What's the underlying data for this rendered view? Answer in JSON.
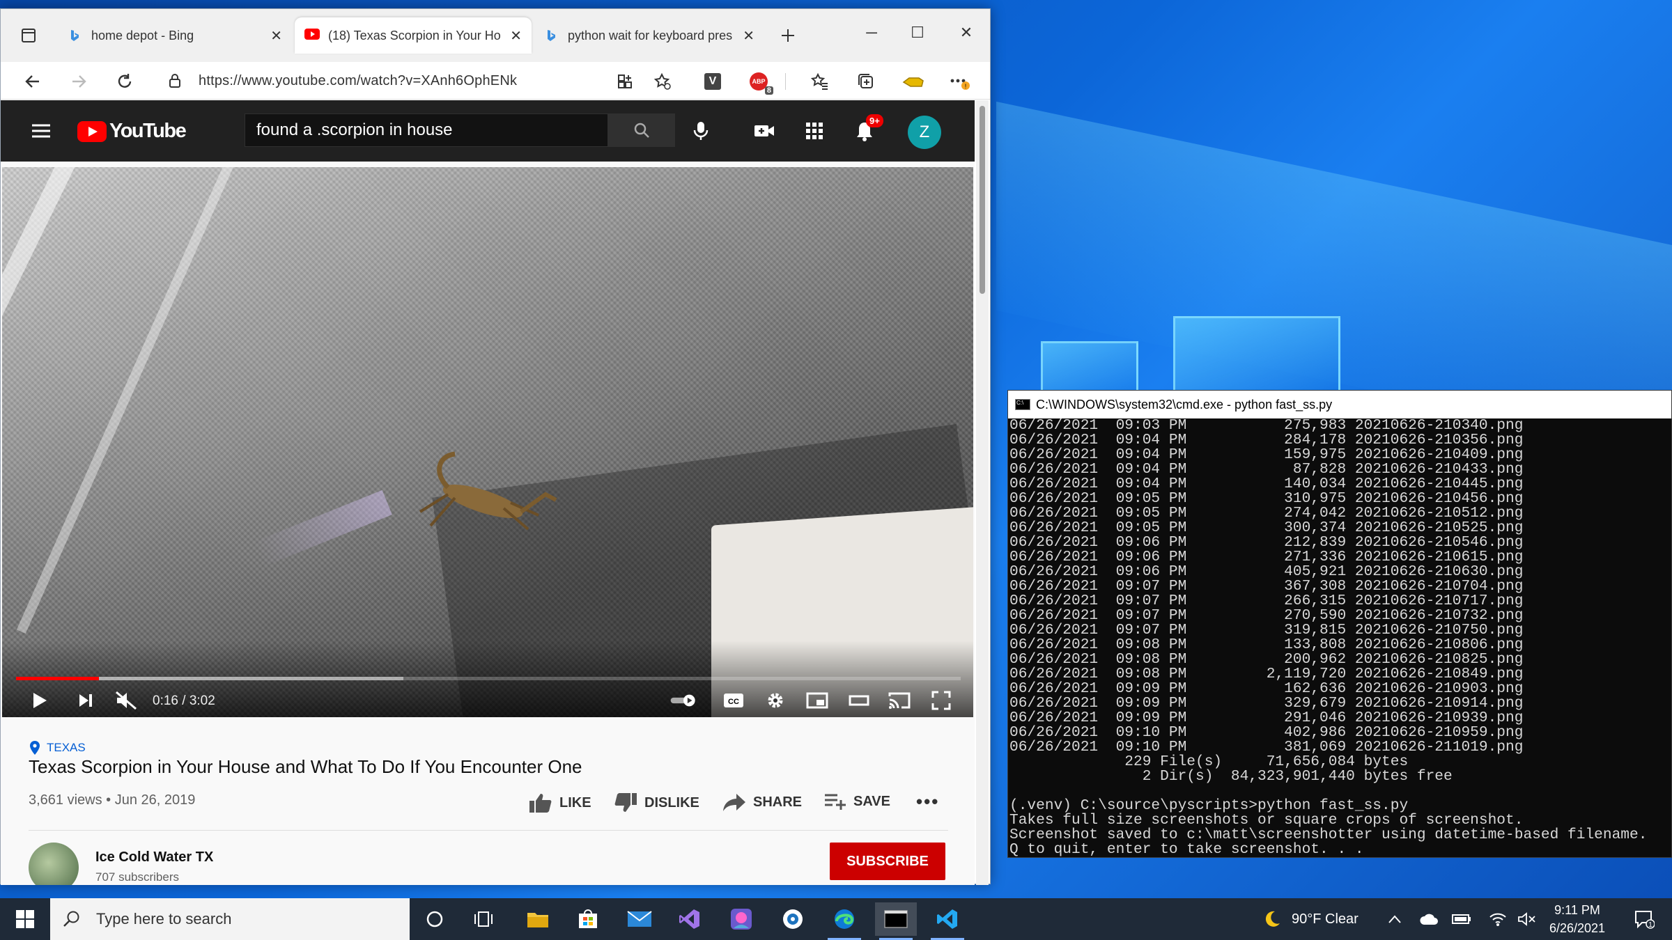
{
  "browser": {
    "tabs": [
      {
        "label": "home depot - Bing",
        "icon": "bing-icon",
        "active": false
      },
      {
        "label": "(18) Texas Scorpion in Your Ho",
        "icon": "youtube-icon",
        "active": true
      },
      {
        "label": "python wait for keyboard pres",
        "icon": "bing-icon",
        "active": false
      }
    ],
    "url": "https://www.youtube.com/watch?v=XAnh6OphENk",
    "extension_v_label": "V",
    "adblock_badge": "8"
  },
  "youtube": {
    "logo_text": "YouTube",
    "search_value": "found a .scorpion in house",
    "notification_badge": "9+",
    "avatar_letter": "Z",
    "player": {
      "time": "0:16 / 3:02",
      "played_fraction": 0.088,
      "buffered_fraction": 0.41
    },
    "video": {
      "location_tag": "TEXAS",
      "title": "Texas Scorpion in Your House and What To Do If You Encounter One",
      "views_date": "3,661 views • Jun 26, 2019",
      "like_label": "LIKE",
      "dislike_label": "DISLIKE",
      "share_label": "SHARE",
      "save_label": "SAVE"
    },
    "channel": {
      "name": "Ice Cold Water TX",
      "subscribers": "707 subscribers",
      "subscribe_label": "SUBSCRIBE"
    }
  },
  "cmd": {
    "title": "C:\\WINDOWS\\system32\\cmd.exe - python  fast_ss.py",
    "lines": [
      "06/26/2021  09:03 PM           275,983 20210626-210340.png",
      "06/26/2021  09:04 PM           284,178 20210626-210356.png",
      "06/26/2021  09:04 PM           159,975 20210626-210409.png",
      "06/26/2021  09:04 PM            87,828 20210626-210433.png",
      "06/26/2021  09:04 PM           140,034 20210626-210445.png",
      "06/26/2021  09:05 PM           310,975 20210626-210456.png",
      "06/26/2021  09:05 PM           274,042 20210626-210512.png",
      "06/26/2021  09:05 PM           300,374 20210626-210525.png",
      "06/26/2021  09:06 PM           212,839 20210626-210546.png",
      "06/26/2021  09:06 PM           271,336 20210626-210615.png",
      "06/26/2021  09:06 PM           405,921 20210626-210630.png",
      "06/26/2021  09:07 PM           367,308 20210626-210704.png",
      "06/26/2021  09:07 PM           266,315 20210626-210717.png",
      "06/26/2021  09:07 PM           270,590 20210626-210732.png",
      "06/26/2021  09:07 PM           319,815 20210626-210750.png",
      "06/26/2021  09:08 PM           133,808 20210626-210806.png",
      "06/26/2021  09:08 PM           200,962 20210626-210825.png",
      "06/26/2021  09:08 PM         2,119,720 20210626-210849.png",
      "06/26/2021  09:09 PM           162,636 20210626-210903.png",
      "06/26/2021  09:09 PM           329,679 20210626-210914.png",
      "06/26/2021  09:09 PM           291,046 20210626-210939.png",
      "06/26/2021  09:10 PM           402,986 20210626-210959.png",
      "06/26/2021  09:10 PM           381,069 20210626-211019.png",
      "             229 File(s)     71,656,084 bytes",
      "               2 Dir(s)  84,323,901,440 bytes free",
      "",
      "(.venv) C:\\source\\pyscripts>python fast_ss.py",
      "Takes full size screenshots or square crops of screenshot.",
      "Screenshot saved to c:\\matt\\screenshotter using datetime-based filename.",
      "Q to quit, enter to take screenshot. . ."
    ]
  },
  "taskbar": {
    "search_placeholder": "Type here to search",
    "weather": "90°F  Clear",
    "time": "9:11 PM",
    "date": "6/26/2021",
    "notification_count": "1"
  },
  "colors": {
    "youtube_red": "#ff0000",
    "subscribe_red": "#cc0000",
    "link_blue": "#065fd4",
    "taskbar": "#1f2a38"
  }
}
